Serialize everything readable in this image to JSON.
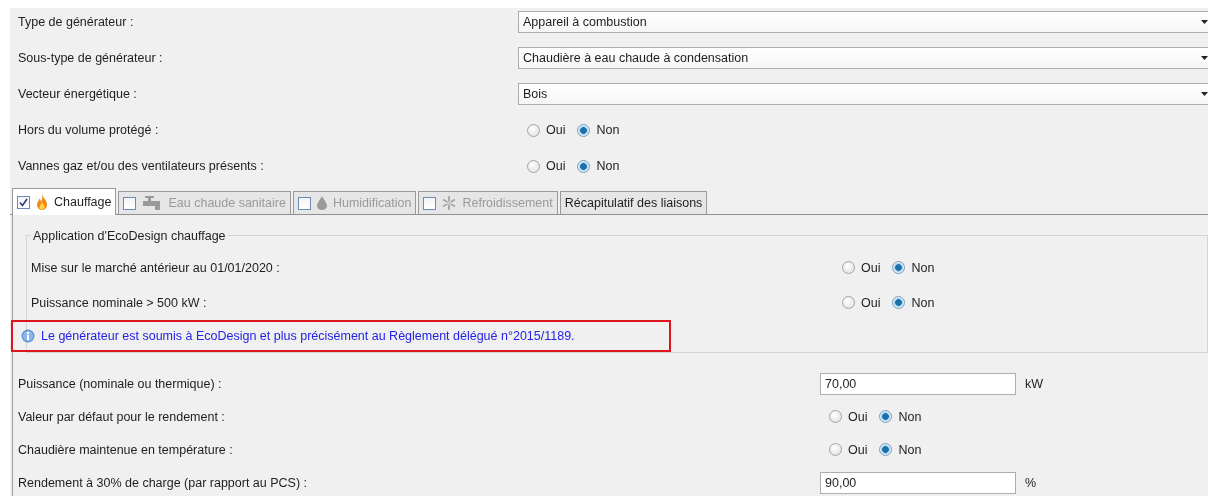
{
  "general": [
    {
      "kind": "select",
      "label": "Type de générateur :",
      "value": "Appareil à combustion"
    },
    {
      "kind": "select",
      "label": "Sous-type de générateur :",
      "value": "Chaudière à eau chaude à condensation"
    },
    {
      "kind": "select",
      "label": "Vecteur énergétique :",
      "value": "Bois"
    },
    {
      "kind": "radio",
      "label": "Hors du volume protégé :",
      "options": [
        {
          "label": "Oui",
          "selected": false
        },
        {
          "label": "Non",
          "selected": true
        }
      ]
    },
    {
      "kind": "radio",
      "label": "Vannes gaz et/ou des ventilateurs présents :",
      "options": [
        {
          "label": "Oui",
          "selected": false
        },
        {
          "label": "Non",
          "selected": true
        }
      ]
    }
  ],
  "tabs": [
    {
      "kind": "check",
      "label": "Chauffage",
      "checked": true,
      "selected": true,
      "disabled": false
    },
    {
      "kind": "check",
      "label": "Eau chaude sanitaire",
      "checked": false,
      "selected": false,
      "disabled": true
    },
    {
      "kind": "check",
      "label": "Humidification",
      "checked": false,
      "selected": false,
      "disabled": true
    },
    {
      "kind": "check",
      "label": "Refroidissement",
      "checked": false,
      "selected": false,
      "disabled": true
    },
    {
      "kind": "plain",
      "label": "Récapitulatif des liaisons",
      "selected": false,
      "disabled": false
    }
  ],
  "ecodesign": {
    "title": "Application d'EcoDesign chauffage",
    "rows": [
      {
        "kind": "radio",
        "label": "Mise sur le marché antérieur au 01/01/2020 :",
        "options": [
          {
            "label": "Oui",
            "selected": false
          },
          {
            "label": "Non",
            "selected": true
          }
        ]
      },
      {
        "kind": "radio",
        "label": "Puissance nominale > 500 kW :",
        "options": [
          {
            "label": "Oui",
            "selected": false
          },
          {
            "label": "Non",
            "selected": true
          }
        ]
      }
    ],
    "notice": "Le générateur est soumis à EcoDesign et plus précisément au Règlement délégué n°2015/1189."
  },
  "details": [
    {
      "kind": "number",
      "label": "Puissance (nominale ou thermique) :",
      "value": "70,00",
      "unit": "kW"
    },
    {
      "kind": "radio",
      "label": "Valeur par défaut pour le rendement :",
      "options": [
        {
          "label": "Oui",
          "selected": false
        },
        {
          "label": "Non",
          "selected": true
        }
      ]
    },
    {
      "kind": "radio",
      "label": "Chaudière maintenue en température :",
      "options": [
        {
          "label": "Oui",
          "selected": false
        },
        {
          "label": "Non",
          "selected": true
        }
      ]
    },
    {
      "kind": "number",
      "label": "Rendement à 30% de charge (par rapport au PCS) :",
      "value": "90,00",
      "unit": "%"
    }
  ]
}
